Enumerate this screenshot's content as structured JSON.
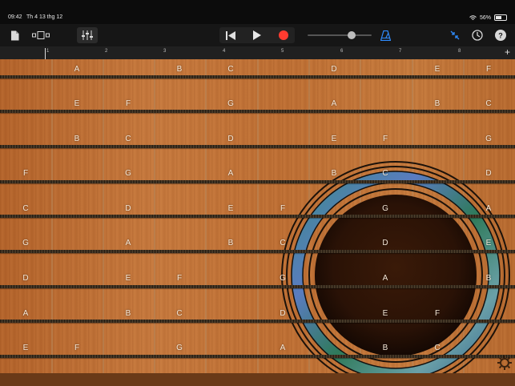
{
  "status_bar": {
    "time": "09:42",
    "date": "Th 4 13 thg 12",
    "battery": "56%"
  },
  "toolbar": {
    "left_icons": [
      "document-icon",
      "view-toggle-icon",
      "mixer-icon"
    ],
    "transport": [
      "rewind-icon",
      "play-icon",
      "record-icon"
    ],
    "right_icons": [
      "metronome-icon",
      "collapse-icon",
      "settings-clock-icon",
      "help-icon"
    ]
  },
  "ruler": {
    "ticks": [
      "1",
      "2",
      "3",
      "4",
      "5",
      "6",
      "7",
      "8"
    ],
    "add_label": "+"
  },
  "fretboard": {
    "rows": [
      [
        "",
        "A",
        "",
        "B",
        "C",
        "",
        "D",
        "",
        "E",
        "F"
      ],
      [
        "",
        "E",
        "F",
        "",
        "G",
        "",
        "A",
        "",
        "B",
        "C"
      ],
      [
        "",
        "B",
        "C",
        "",
        "D",
        "",
        "E",
        "F",
        "",
        "G"
      ],
      [
        "F",
        "",
        "G",
        "",
        "A",
        "",
        "B",
        "C",
        "",
        "D"
      ],
      [
        "C",
        "",
        "D",
        "",
        "E",
        "F",
        "",
        "G",
        "",
        "A"
      ],
      [
        "G",
        "",
        "A",
        "",
        "B",
        "C",
        "",
        "D",
        "",
        "E"
      ],
      [
        "D",
        "",
        "E",
        "F",
        "",
        "G",
        "",
        "A",
        "",
        "B"
      ],
      [
        "A",
        "",
        "B",
        "C",
        "",
        "D",
        "",
        "E",
        "F",
        ""
      ],
      [
        "E",
        "F",
        "",
        "G",
        "",
        "A",
        "",
        "B",
        "C",
        ""
      ]
    ]
  },
  "colors": {
    "record": "#ff3b30",
    "accent": "#2f8cff",
    "wood": "#c27637"
  }
}
